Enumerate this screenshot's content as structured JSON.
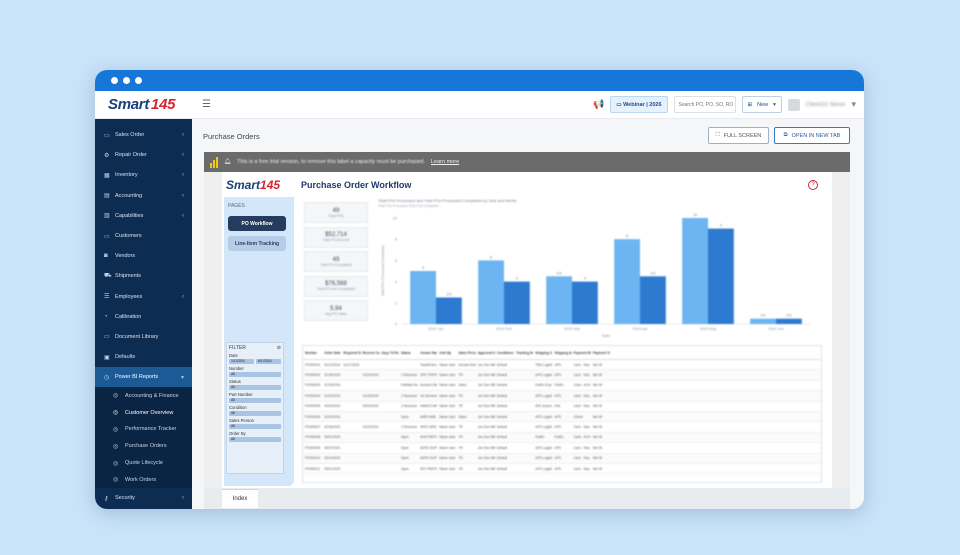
{
  "brand": {
    "name": "Smart",
    "num": "145"
  },
  "topbar": {
    "webinar": "Webinar | 2026",
    "search_placeholder": "Search PO, PO, SO, RO",
    "new_label": "New",
    "user_name": "Client111 Simon"
  },
  "sidebar": {
    "items": [
      {
        "label": "Sales Order",
        "icon": "cart-icon",
        "glyph": "▭",
        "chevron": true
      },
      {
        "label": "Repair Order",
        "icon": "wrench-icon",
        "glyph": "⚙",
        "chevron": true
      },
      {
        "label": "Inventory",
        "icon": "box-icon",
        "glyph": "▦",
        "chevron": true
      },
      {
        "label": "Accounting",
        "icon": "ledger-icon",
        "glyph": "▤",
        "chevron": true
      },
      {
        "label": "Capabilities",
        "icon": "list-icon",
        "glyph": "▥",
        "chevron": true
      },
      {
        "label": "Customers",
        "icon": "users-icon",
        "glyph": "▭",
        "chevron": false
      },
      {
        "label": "Vendors",
        "icon": "vendor-icon",
        "glyph": "◙",
        "chevron": false
      },
      {
        "label": "Shipments",
        "icon": "truck-icon",
        "glyph": "⛟",
        "chevron": false
      },
      {
        "label": "Employees",
        "icon": "employee-icon",
        "glyph": "☰",
        "chevron": true
      },
      {
        "label": "Calibration",
        "icon": "calibration-icon",
        "glyph": "◔",
        "chevron": false
      },
      {
        "label": "Document Library",
        "icon": "document-icon",
        "glyph": "▭",
        "chevron": false
      },
      {
        "label": "Defaults",
        "icon": "defaults-icon",
        "glyph": "▣",
        "chevron": false
      }
    ],
    "active": {
      "label": "Power BI Reports",
      "icon": "chart-icon",
      "glyph": "◷"
    },
    "sub_items": [
      {
        "label": "Accounting & Finance"
      },
      {
        "label": "Customer Overview"
      },
      {
        "label": "Performance Tracker"
      },
      {
        "label": "Purchase Orders"
      },
      {
        "label": "Quote Lifecycle"
      },
      {
        "label": "Work Orders"
      }
    ],
    "security": {
      "label": "Security"
    }
  },
  "main": {
    "title": "Purchase Orders",
    "full_screen": "FULL SCREEN",
    "open_new_tab": "OPEN IN NEW TAB",
    "trial_msg": "This is a free trial version, to remove this label a capacity must be purchased.",
    "learn_more": "Learn more"
  },
  "report": {
    "title": "Purchase Order Workflow",
    "pages_label": "PAGES",
    "page_buttons": [
      "PO Workflow",
      "Line-Item Tracking"
    ],
    "filter_title": "FILTER",
    "filter_dates": [
      "1/1/2024",
      "6/1/2024"
    ],
    "filter_fields": [
      "Number",
      "Status",
      "Part Number",
      "Condition",
      "Sales Person",
      "Order By"
    ],
    "filter_date_label": "Date",
    "filter_value": "All",
    "kpis": [
      {
        "value": "49",
        "caption": "Total POs"
      },
      {
        "value": "$52,714",
        "caption": "Total PO Amount"
      },
      {
        "value": "49",
        "caption": "Total PO Completed"
      },
      {
        "value": "$76,568",
        "caption": "Total PO Amt Completed"
      },
      {
        "value": "5.94",
        "caption": "Avg PO Value"
      }
    ],
    "table_headers": [
      "Number",
      "Order Date",
      "Required Date",
      "Receive Complete Date",
      "Days Til Rcv Status",
      "Status",
      "Vendor Name",
      "Ordr By",
      "Sales Person",
      "Approved By",
      "Conditions",
      "Tracking Number",
      "Shipping Service",
      "Shipping Account",
      "Payment Method",
      "Payment Term"
    ],
    "table_rows": [
      [
        "PO000001",
        "01/12/2024",
        "01/17/2024",
        "",
        "",
        "",
        "TestAEVendor",
        "Name User",
        "Donald Smith",
        "Jon Doe Miller",
        "Default",
        "",
        "TMS Logistics",
        "UPS",
        "Card - Visa",
        "Net 30"
      ],
      [
        "PO000002",
        "01/15/2024",
        "",
        "01/20/2024",
        "",
        "1 Received",
        "UPS TRSPORTATION",
        "Name User",
        "TR",
        "Jon Doe Miller",
        "Default",
        "",
        "UPS Logistics",
        "UPS",
        "Card - Visa",
        "Net 30"
      ],
      [
        "PO000003",
        "01/19/2024",
        "",
        "",
        "",
        "Partially Recvd",
        "Avionics Maintenance",
        "Name User",
        "Sales",
        "Jon Doe Miller",
        "Default",
        "",
        "FedEx Express",
        "FedEx",
        "Cash - ACH",
        "Net 30"
      ],
      [
        "PO000004",
        "01/22/2024",
        "",
        "01/25/2024",
        "",
        "1 Received",
        "Jet Services",
        "Name User",
        "TR",
        "Jon Doe Miller",
        "Default",
        "",
        "UPS Logistics",
        "UPS",
        "Card - Visa",
        "Net 30"
      ],
      [
        "PO000005",
        "02/02/2024",
        "",
        "02/09/2024",
        "",
        "1 Received",
        "HAWKS MAINTENANCE",
        "Name User",
        "TR",
        "Jon Doe Miller",
        "Default",
        "",
        "DHL Express",
        "DHL",
        "Card - Visa",
        "Net 30"
      ],
      [
        "PO000006",
        "02/10/2024",
        "",
        "",
        "",
        "Open",
        "AIRPLANE PARTS",
        "Name User",
        "Sales",
        "Jon Doe Miller",
        "Default",
        "",
        "UPS Logistics",
        "UPS",
        "Check",
        "Net 30"
      ],
      [
        "PO000007",
        "02/18/2024",
        "",
        "02/22/2024",
        "",
        "1 Received",
        "APEX AIRCRAFT",
        "Name User",
        "TR",
        "Jon Doe Miller",
        "Default",
        "",
        "UPS Logistics",
        "UPS",
        "Card - Visa",
        "Net 30"
      ],
      [
        "PO000008",
        "03/01/2024",
        "",
        "",
        "",
        "Open",
        "AVIA PARTS",
        "Name User",
        "TR",
        "Jon Doe Miller",
        "Default",
        "",
        "FedEx",
        "FedEx",
        "Cash - ACH",
        "Net 30"
      ],
      [
        "PO000009",
        "03/07/2024",
        "",
        "",
        "",
        "Open",
        "AERO SUPPLY",
        "Name User",
        "TR",
        "Jon Doe Miller",
        "Default",
        "",
        "UPS Logistics",
        "UPS",
        "Card - Visa",
        "Net 30"
      ],
      [
        "PO000010",
        "03/14/2024",
        "",
        "",
        "",
        "Open",
        "AERO SUPPLY",
        "Name User",
        "TR",
        "Jon Doe Miller",
        "Default",
        "",
        "UPS Logistics",
        "UPS",
        "Card - Visa",
        "Net 30"
      ],
      [
        "PO000011",
        "03/21/2024",
        "",
        "",
        "",
        "Open",
        "SKY PARTS",
        "Name User",
        "TR",
        "Jon Doe Miller",
        "Default",
        "",
        "UPS Logistics",
        "UPS",
        "Card - Visa",
        "Net 30"
      ]
    ],
    "tab_label": "Index"
  },
  "chart_data": {
    "type": "bar",
    "title": "Total POs Processed and Total POs Processed Completed by Year and Month",
    "subtitle": "Total POs Processed   Total POs Completed",
    "xlabel": "Date",
    "ylabel": "Total POs Processed Completed",
    "ylim": [
      0,
      10
    ],
    "categories": [
      "2024 Jan",
      "2024 Feb",
      "2024 Mar",
      "2024 Apr",
      "2024 May",
      "2024 Jun"
    ],
    "series": [
      {
        "name": "Total POs Processed",
        "values": [
          5,
          6,
          4.5,
          8,
          10,
          0.5
        ],
        "color": "#6cb4f2"
      },
      {
        "name": "Total POs Completed",
        "values": [
          2.5,
          4,
          4,
          4.5,
          9,
          0.5
        ],
        "color": "#2e7ad0"
      }
    ],
    "yticks": [
      0,
      2,
      4,
      6,
      8,
      10
    ],
    "grid": false
  }
}
